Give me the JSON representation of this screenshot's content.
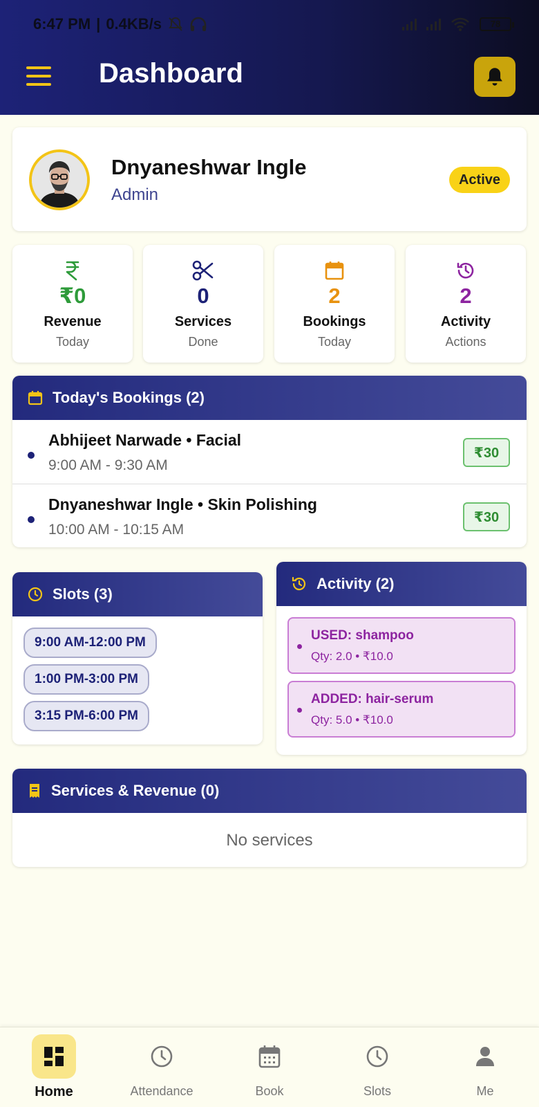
{
  "status_bar": {
    "time": "6:47 PM",
    "speed": "0.4KB/s",
    "battery": "78"
  },
  "header": {
    "title": "Dashboard"
  },
  "profile": {
    "name": "Dnyaneshwar Ingle",
    "role": "Admin",
    "status": "Active"
  },
  "stats": [
    {
      "value": "₹0",
      "label": "Revenue",
      "sub": "Today",
      "icon": "rupee-icon",
      "color": "#2e9b3a"
    },
    {
      "value": "0",
      "label": "Services",
      "sub": "Done",
      "icon": "scissors-icon",
      "color": "#1d2277"
    },
    {
      "value": "2",
      "label": "Bookings",
      "sub": "Today",
      "icon": "calendar-icon",
      "color": "#e8920f"
    },
    {
      "value": "2",
      "label": "Activity",
      "sub": "Actions",
      "icon": "history-icon",
      "color": "#8d24a0"
    }
  ],
  "bookings": {
    "title": "Today's Bookings (2)",
    "items": [
      {
        "title": "Abhijeet Narwade • Facial",
        "time": "9:00 AM - 9:30 AM",
        "price": "₹30"
      },
      {
        "title": "Dnyaneshwar Ingle • Skin Polishing",
        "time": "10:00 AM - 10:15 AM",
        "price": "₹30"
      }
    ]
  },
  "slots": {
    "title": "Slots (3)",
    "items": [
      "9:00 AM-12:00 PM",
      "1:00 PM-3:00 PM",
      "3:15 PM-6:00 PM"
    ]
  },
  "activity": {
    "title": "Activity (2)",
    "items": [
      {
        "title": "USED: shampoo",
        "detail": "Qty: 2.0 • ₹10.0"
      },
      {
        "title": "ADDED: hair-serum",
        "detail": "Qty: 5.0 • ₹10.0"
      }
    ]
  },
  "services": {
    "title": "Services & Revenue (0)",
    "empty": "No services"
  },
  "nav": [
    {
      "label": "Home",
      "icon": "dashboard-icon",
      "active": true
    },
    {
      "label": "Attendance",
      "icon": "clock-icon",
      "active": false
    },
    {
      "label": "Book",
      "icon": "calendar-icon",
      "active": false
    },
    {
      "label": "Slots",
      "icon": "clock-icon",
      "active": false
    },
    {
      "label": "Me",
      "icon": "person-icon",
      "active": false
    }
  ],
  "colors": {
    "primary": "#1d2277",
    "accent": "#f3c417",
    "success": "#2e9b3a",
    "purple": "#8d24a0",
    "orange": "#e8920f"
  }
}
